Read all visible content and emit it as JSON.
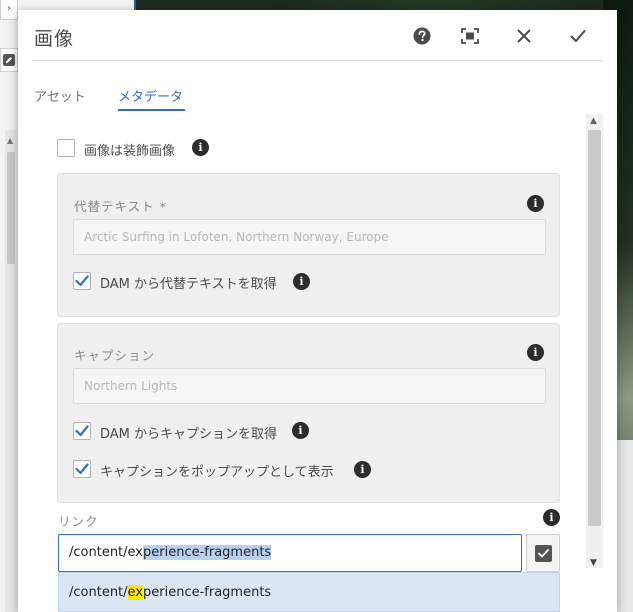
{
  "dialog": {
    "title": "画像",
    "header_buttons": {
      "help": "help-icon",
      "fullscreen": "fullscreen-icon",
      "close": "close-icon",
      "done": "checkmark-icon"
    }
  },
  "tabs": [
    {
      "label": "アセット",
      "active": false
    },
    {
      "label": "メタデータ",
      "active": true
    }
  ],
  "form": {
    "decorative_checkbox": {
      "label": "画像は装飾画像",
      "checked": false
    },
    "alt_text": {
      "label": "代替テキスト *",
      "placeholder": "Arctic Surfing in Lofoten, Northern Norway, Europe",
      "dam_checkbox": {
        "label": "DAM から代替テキストを取得",
        "checked": true
      }
    },
    "caption": {
      "label": "キャプション",
      "placeholder": "Northern Lights",
      "dam_checkbox": {
        "label": "DAM からキャプションを取得",
        "checked": true
      },
      "popup_checkbox": {
        "label": "キャプションをポップアップとして表示",
        "checked": true
      }
    },
    "link": {
      "label": "リンク",
      "value_prefix": "/content/ex",
      "value_selected": "perience-fragments",
      "suggestion_prefix": "/content/",
      "suggestion_highlight": "ex",
      "suggestion_suffix": "perience-fragments"
    }
  },
  "colors": {
    "accent": "#326ec8",
    "checkmark": "#326ec8",
    "highlight": "#ffe600",
    "selection": "#b9d1f1"
  }
}
